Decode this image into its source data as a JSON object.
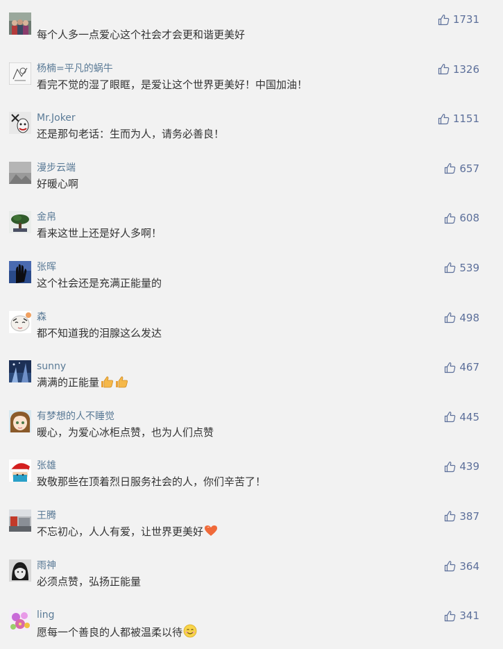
{
  "comments": [
    {
      "user": "​",
      "text": "每个人多一点爱心这个社会才会更和谐更美好",
      "likes": "1731",
      "avatar": "group-photo-avatar",
      "emoji": []
    },
    {
      "user": "杨楠=平凡的蜗牛",
      "text": "看完不觉的湿了眼眶，是爱让这个世界更美好！中国加油！",
      "likes": "1326",
      "avatar": "sketch-avatar",
      "emoji": []
    },
    {
      "user": "Mr.Joker",
      "text": "还是那句老话：生而为人，请务必善良！",
      "likes": "1151",
      "avatar": "joker-avatar",
      "emoji": []
    },
    {
      "user": "漫步云端",
      "text": "好暖心啊",
      "likes": "657",
      "avatar": "gray-avatar",
      "emoji": []
    },
    {
      "user": "金帛",
      "text": "看来这世上还是好人多啊！",
      "likes": "608",
      "avatar": "bonsai-avatar",
      "emoji": []
    },
    {
      "user": "张晖",
      "text": "这个社会还是充满正能量的",
      "likes": "539",
      "avatar": "hand-avatar",
      "emoji": []
    },
    {
      "user": "森",
      "text": "都不知道我的泪腺这么发达",
      "likes": "498",
      "avatar": "cartoon-face-avatar",
      "emoji": []
    },
    {
      "user": "sunny",
      "text": "满满的正能量",
      "likes": "467",
      "avatar": "night-scene-avatar",
      "emoji": [
        "thumbs-up-emoji",
        "thumbs-up-emoji"
      ]
    },
    {
      "user": "有梦想的人不睡觉",
      "text": "暖心，为爱心冰柜点赞，也为人们点赞",
      "likes": "445",
      "avatar": "anime-avatar",
      "emoji": []
    },
    {
      "user": "张雄",
      "text": "致敬那些在顶着烈日服务社会的人，你们辛苦了！",
      "likes": "439",
      "avatar": "santa-hat-avatar",
      "emoji": []
    },
    {
      "user": "王腾",
      "text": "不忘初心，人人有爱，让世界更美好",
      "likes": "387",
      "avatar": "street-avatar",
      "emoji": [
        "heart-emoji"
      ]
    },
    {
      "user": "雨神",
      "text": "必须点赞，弘扬正能量",
      "likes": "364",
      "avatar": "bw-portrait-avatar",
      "emoji": []
    },
    {
      "user": "ling",
      "text": "愿每一个善良的人都被温柔以待",
      "likes": "341",
      "avatar": "flower-avatar",
      "emoji": [
        "smile-emoji"
      ]
    }
  ],
  "colors": {
    "background": "#f2f2f2",
    "username": "#5a7a96",
    "text": "#333333",
    "like": "#5c6f9a"
  }
}
